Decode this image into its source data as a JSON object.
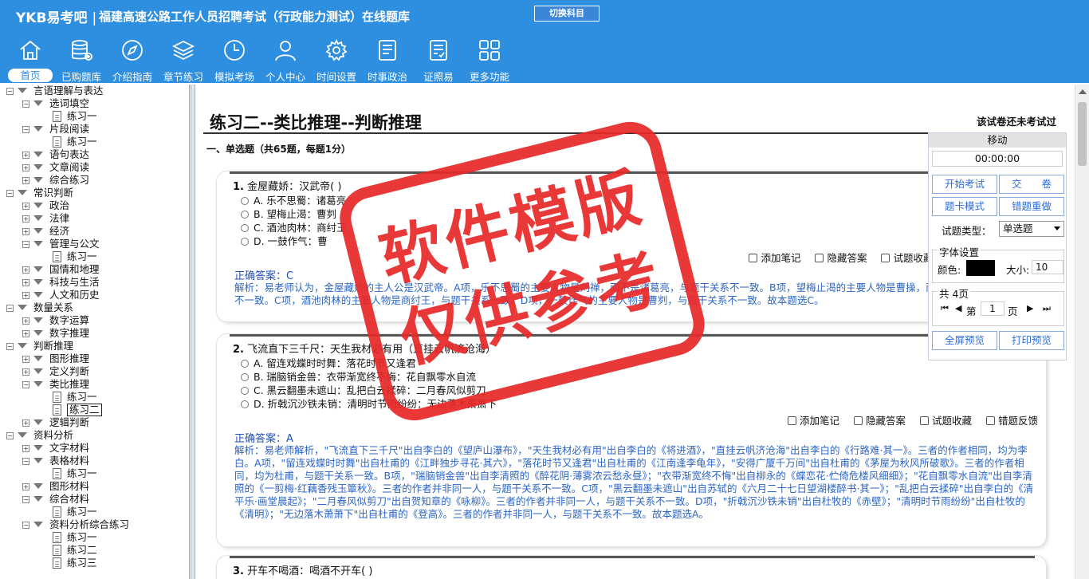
{
  "header": {
    "logo": "YKB易考吧",
    "title": "福建高速公路工作人员招聘考试（行政能力测试）在线题库",
    "switch_label": "切换科目",
    "nav": [
      {
        "label": "首页",
        "icon": "home-icon"
      },
      {
        "label": "已购题库",
        "icon": "database-icon"
      },
      {
        "label": "介绍指南",
        "icon": "compass-icon"
      },
      {
        "label": "章节练习",
        "icon": "layers-icon"
      },
      {
        "label": "模拟考场",
        "icon": "clock-icon"
      },
      {
        "label": "个人中心",
        "icon": "user-icon"
      },
      {
        "label": "时间设置",
        "icon": "gear-icon"
      },
      {
        "label": "时事政治",
        "icon": "news-icon"
      },
      {
        "label": "证照易",
        "icon": "clipboard-icon"
      },
      {
        "label": "更多功能",
        "icon": "grid-icon"
      }
    ]
  },
  "tree": [
    {
      "text": "言语理解与表达",
      "level": 0,
      "type": "open"
    },
    {
      "text": "选词填空",
      "level": 1,
      "type": "open"
    },
    {
      "text": "练习一",
      "level": 2,
      "type": "file"
    },
    {
      "text": "片段阅读",
      "level": 1,
      "type": "open"
    },
    {
      "text": "练习一",
      "level": 2,
      "type": "file"
    },
    {
      "text": "语句表达",
      "level": 1,
      "type": "closed"
    },
    {
      "text": "文章阅读",
      "level": 1,
      "type": "closed"
    },
    {
      "text": "综合练习",
      "level": 1,
      "type": "closed"
    },
    {
      "text": "常识判断",
      "level": 0,
      "type": "open"
    },
    {
      "text": "政治",
      "level": 1,
      "type": "closed"
    },
    {
      "text": "法律",
      "level": 1,
      "type": "closed"
    },
    {
      "text": "经济",
      "level": 1,
      "type": "closed"
    },
    {
      "text": "管理与公文",
      "level": 1,
      "type": "open"
    },
    {
      "text": "练习一",
      "level": 2,
      "type": "file"
    },
    {
      "text": "国情和地理",
      "level": 1,
      "type": "closed"
    },
    {
      "text": "科技与生活",
      "level": 1,
      "type": "closed"
    },
    {
      "text": "人文和历史",
      "level": 1,
      "type": "closed"
    },
    {
      "text": "数量关系",
      "level": 0,
      "type": "open"
    },
    {
      "text": "数字运算",
      "level": 1,
      "type": "closed"
    },
    {
      "text": "数字推理",
      "level": 1,
      "type": "closed"
    },
    {
      "text": "判断推理",
      "level": 0,
      "type": "open"
    },
    {
      "text": "图形推理",
      "level": 1,
      "type": "closed"
    },
    {
      "text": "定义判断",
      "level": 1,
      "type": "closed"
    },
    {
      "text": "类比推理",
      "level": 1,
      "type": "open"
    },
    {
      "text": "练习一",
      "level": 2,
      "type": "file"
    },
    {
      "text": "练习二",
      "level": 2,
      "type": "file",
      "selected": true
    },
    {
      "text": "逻辑判断",
      "level": 1,
      "type": "closed"
    },
    {
      "text": "资料分析",
      "level": 0,
      "type": "open"
    },
    {
      "text": "文字材料",
      "level": 1,
      "type": "closed"
    },
    {
      "text": "表格材料",
      "level": 1,
      "type": "open"
    },
    {
      "text": "练习一",
      "level": 2,
      "type": "file"
    },
    {
      "text": "图形材料",
      "level": 1,
      "type": "closed"
    },
    {
      "text": "综合材料",
      "level": 1,
      "type": "open"
    },
    {
      "text": "练习一",
      "level": 2,
      "type": "file"
    },
    {
      "text": "资料分析综合练习",
      "level": 1,
      "type": "open"
    },
    {
      "text": "练习一",
      "level": 2,
      "type": "file"
    },
    {
      "text": "练习二",
      "level": 2,
      "type": "file"
    },
    {
      "text": "练习三",
      "level": 2,
      "type": "file"
    }
  ],
  "main": {
    "page_title": "练习二--类比推理--判断推理",
    "not_tried": "该试卷还未考试过",
    "section": "一、单选题（共65题，每题1分）",
    "q1": {
      "stem_num": "1.",
      "stem": "金屋藏娇：汉武帝(    )",
      "options": [
        "A. 乐不思蜀：诸葛亮",
        "B. 望梅止渴：曹刿",
        "C. 酒池肉林：商纣王",
        "D. 一鼓作气：曹"
      ],
      "tools": [
        "添加笔记",
        "隐藏答案",
        "试题收藏",
        "错"
      ],
      "answer": "正确答案：C",
      "analysis": "解析：易老师认为，金屋藏娇的主人公是汉武帝。A项，乐不思蜀的主要人物是刘禅，而不是诸葛亮，与题干关系不一致。B项，望梅止渴的主要人物是曹操，而不是曹刿，与题干关系不一致。C项，酒池肉林的主要人物是商纣王，与题干关系一致。D项，一鼓作气的主要人物是曹刿，与题干关系不一致。故本题选C。"
    },
    "q2": {
      "stem_num": "2.",
      "stem": "飞流直下三千尺：天生我材必有用（直挂云帆济沧海）",
      "options": [
        "A. 留连戏蝶时时舞：落花时节又逢君",
        "B. 瑞脑销金兽：衣带渐宽终不悔：花自飘零水自流",
        "C. 黑云翻墨未遮山：乱把白云揉碎：二月春风似剪刀",
        "D. 折戟沉沙铁未销：清明时节雨纷纷：无边落木萧萧下"
      ],
      "tools": [
        "添加笔记",
        "隐藏答案",
        "试题收藏",
        "错题反馈"
      ],
      "answer": "正确答案：A",
      "analysis": "解析：易老师解析，\"飞流直下三千尺\"出自李白的《望庐山瀑布》，\"天生我材必有用\"出自李白的《将进酒》，\"直挂云帆济沧海\"出自李白的《行路难·其一》。三者的作者相同，均为李白。A项，\"留连戏蝶时时舞\"出自杜甫的《江畔独步寻花·其六》，\"落花时节又逢君\"出自杜甫的《江南逢李龟年》，\"安得广厦千万间\"出自杜甫的《茅屋为秋风所破歌》。三者的作者相同，均为杜甫，与题干关系一致。B项，\"瑞脑销金兽\"出自李清照的《醉花阴·薄雾浓云愁永昼》；\"衣带渐宽终不悔\"出自柳永的《蝶恋花·伫倚危楼风细细》；\"花自飘零水自流\"出自李清照的《一剪梅·红藕香残玉簟秋》。三者的作者并非同一人，与题干关系不一致。C项，\"黑云翻墨未遮山\"出自苏轼的《六月二十七日望湖楼醉书·其一》；\"乱把白云揉碎\"出自李白的《清平乐·画堂晨起》；\"二月春风似剪刀\"出自贺知章的《咏柳》。三者的作者并非同一人，与题干关系不一致。D项，\"折戟沉沙铁未销\"出自杜牧的《赤壁》；\"清明时节雨纷纷\"出自杜牧的《清明》；\"无边落木萧萧下\"出自杜甫的《登高》。三者的作者并非同一人，与题干关系不一致。故本题选A。"
    },
    "q3": {
      "stem_num": "3.",
      "stem": "开车不喝酒：喝酒不开车(    )"
    }
  },
  "panel": {
    "head": "移动",
    "timer": "00:00:00",
    "start": "开始考试",
    "submit": "交　　卷",
    "card_mode": "题卡模式",
    "redo": "错题重做",
    "type_label": "试题类型：",
    "type_value": "单选题",
    "font_legend": "字体设置",
    "color_label": "颜色:",
    "size_label": "大小:",
    "size_value": "10",
    "pages_legend": "共 4页",
    "page_prefix": "第",
    "page_value": "1",
    "page_suffix": "页",
    "fullscreen": "全屏预览",
    "print": "打印预览"
  },
  "stamp": {
    "line1": "软件模版",
    "line2": "仅供参考"
  },
  "colors": {
    "header": "#2e8ee0",
    "answer": "#1f4fb8",
    "analysis": "#2d66c4",
    "stamp": "#e82929"
  }
}
